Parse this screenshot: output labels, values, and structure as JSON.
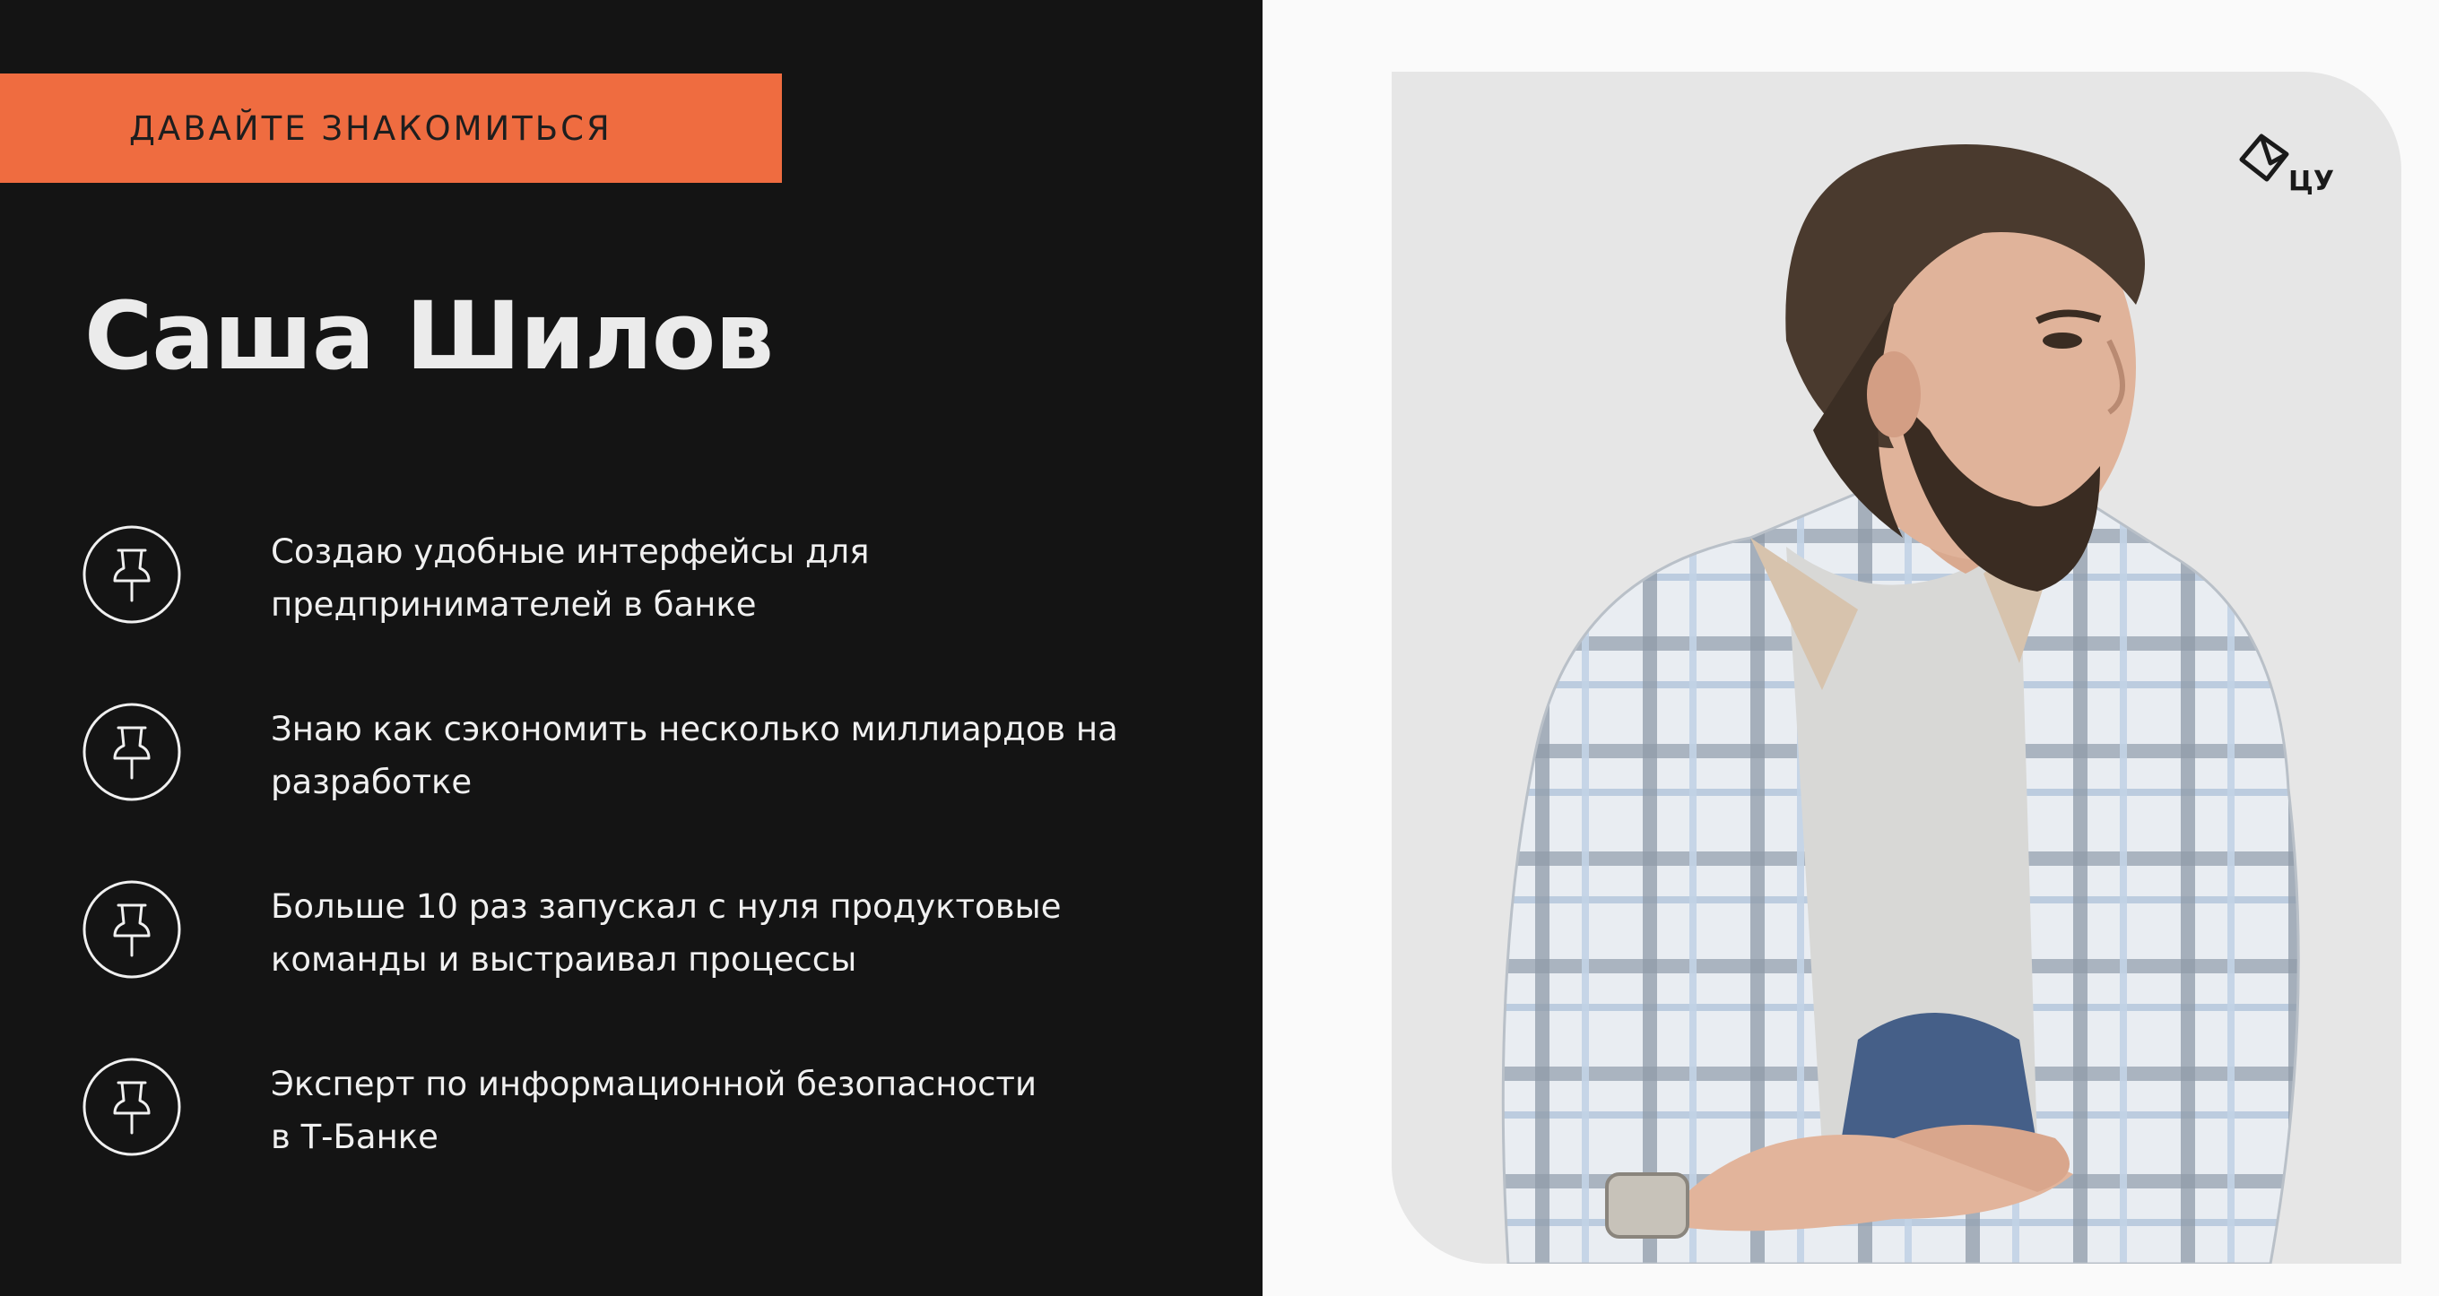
{
  "slide": {
    "tag_label": "ДАВАЙТЕ ЗНАКОМИТЬСЯ",
    "name": "Саша Шилов",
    "facts": [
      {
        "icon": "pushpin-icon",
        "text": "Создаю удобные интерфейсы для\nпредпринимателей в банке"
      },
      {
        "icon": "pushpin-icon",
        "text": "Знаю как сэкономить несколько миллиардов на\nразработке"
      },
      {
        "icon": "pushpin-icon",
        "text": "Больше 10 раз запускал с нуля продуктовые\nкоманды и выстраивал процессы"
      },
      {
        "icon": "pushpin-icon",
        "text": "Эксперт по информационной безопасности\nв Т-Банке"
      }
    ],
    "logo_text": "ЦУ",
    "colors": {
      "accent": "#ef6c40",
      "panel_bg": "#141414",
      "text_light": "#f0f0f0",
      "photo_bg": "#e6e6e6"
    }
  }
}
